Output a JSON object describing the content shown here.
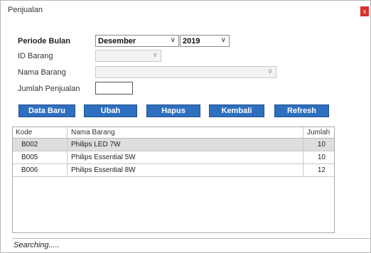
{
  "window": {
    "title": "Penjualan",
    "close_label": "x"
  },
  "form": {
    "periode_label": "Periode Bulan",
    "bulan_value": "Desember",
    "tahun_value": "2019",
    "id_barang_label": "ID Barang",
    "nama_barang_label": "Nama Barang",
    "jumlah_label": "Jumlah Penjualan",
    "arrow": "∨"
  },
  "buttons": {
    "data_baru": "Data Baru",
    "ubah": "Ubah",
    "hapus": "Hapus",
    "kembali": "Kembali",
    "refresh": "Refresh"
  },
  "table": {
    "headers": [
      "Kode",
      "Nama Barang",
      "Jumlah"
    ],
    "rows": [
      [
        "B002",
        "Philips LED 7W",
        "10"
      ],
      [
        "B005",
        "Philips Essential 5W",
        "10"
      ],
      [
        "B006",
        "Philips Essential 8W",
        "12"
      ]
    ],
    "selected_row": 0
  },
  "status": {
    "text": "Searching....."
  },
  "colors": {
    "button_bg": "#2f6fc0",
    "close_bg": "#d8302c",
    "selected_row_bg": "#dedede"
  }
}
